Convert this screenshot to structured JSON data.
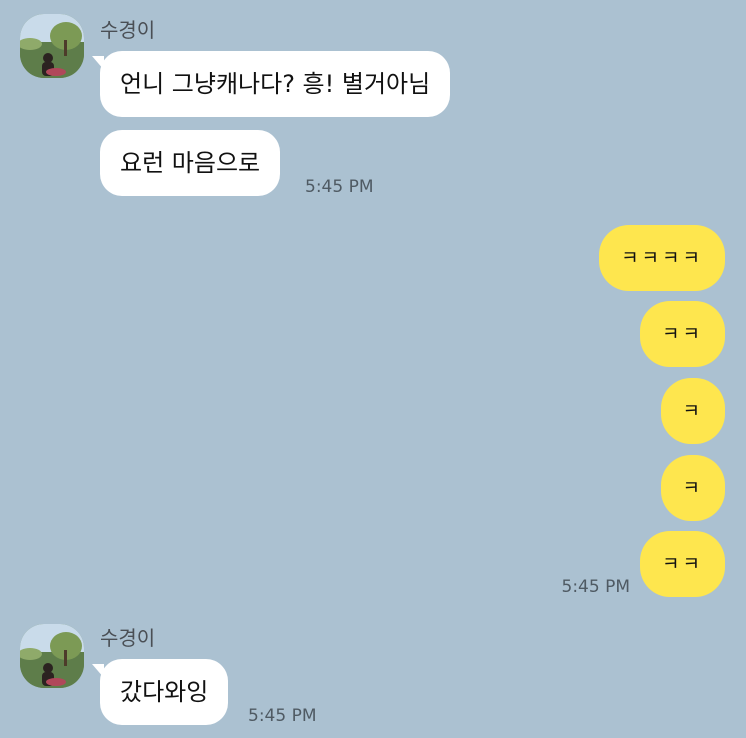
{
  "colors": {
    "background": "#abc1d1",
    "incoming_bubble": "#ffffff",
    "outgoing_bubble": "#fee64e"
  },
  "group1": {
    "sender": "수경이",
    "messages": [
      "언니 그냥캐나다? 흥! 별거아님",
      "요런 마음으로"
    ],
    "time": "5:45 PM"
  },
  "outgoing": {
    "messages": [
      "ㅋㅋㅋㅋ",
      "ㅋㅋ",
      "ㅋ",
      "ㅋ",
      "ㅋㅋ"
    ],
    "time": "5:45 PM"
  },
  "group2": {
    "sender": "수경이",
    "messages": [
      "갔다와잉"
    ],
    "time": "5:45 PM"
  }
}
